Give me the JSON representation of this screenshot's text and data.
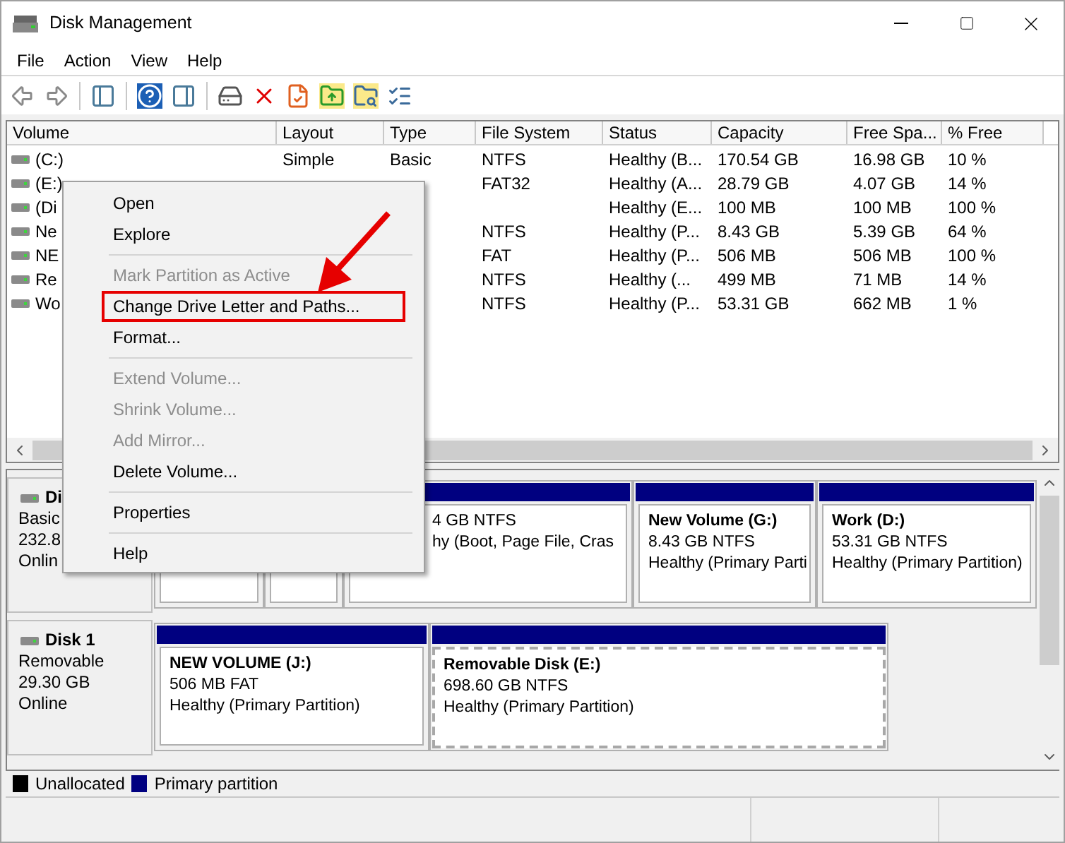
{
  "window": {
    "title": "Disk Management"
  },
  "menu_bar": [
    "File",
    "Action",
    "View",
    "Help"
  ],
  "table": {
    "columns": [
      "Volume",
      "Layout",
      "Type",
      "File System",
      "Status",
      "Capacity",
      "Free Spa...",
      "% Free"
    ],
    "rows": [
      {
        "volume": "(C:)",
        "layout": "Simple",
        "type": "Basic",
        "file_system": "NTFS",
        "status": "Healthy (B...",
        "capacity": "170.54 GB",
        "free_space": "16.98 GB",
        "percent_free": "10 %"
      },
      {
        "volume": "(E:)",
        "file_system": "FAT32",
        "status": "Healthy (A...",
        "capacity": "28.79 GB",
        "free_space": "4.07 GB",
        "percent_free": "14 %"
      },
      {
        "volume": "(Di",
        "status": "Healthy (E...",
        "capacity": "100 MB",
        "free_space": "100 MB",
        "percent_free": "100 %"
      },
      {
        "volume": "Ne",
        "file_system": "NTFS",
        "status": "Healthy (P...",
        "capacity": "8.43 GB",
        "free_space": "5.39 GB",
        "percent_free": "64 %"
      },
      {
        "volume": "NE",
        "file_system": "FAT",
        "status": "Healthy (P...",
        "capacity": "506 MB",
        "free_space": "506 MB",
        "percent_free": "100 %"
      },
      {
        "volume": "Re",
        "file_system": "NTFS",
        "status": "Healthy (...",
        "capacity": "499 MB",
        "free_space": "71 MB",
        "percent_free": "14 %"
      },
      {
        "volume": "Wo",
        "file_system": "NTFS",
        "status": "Healthy (P...",
        "capacity": "53.31 GB",
        "free_space": "662 MB",
        "percent_free": "1 %"
      }
    ]
  },
  "disks": [
    {
      "name": "Di",
      "lines": [
        "Basic",
        "232.8",
        "Onlin"
      ],
      "partitions": [
        {
          "selected": false
        },
        {
          "selected": false
        },
        {
          "size": "4 GB NTFS",
          "status": "hy (Boot, Page File, Cras",
          "selected": false
        },
        {
          "title": "New Volume  (G:)",
          "size": "8.43 GB NTFS",
          "status": "Healthy (Primary Parti",
          "selected": false
        },
        {
          "title": "Work  (D:)",
          "size": "53.31 GB NTFS",
          "status": "Healthy (Primary Partition)",
          "selected": false
        }
      ]
    },
    {
      "name": "Disk 1",
      "lines": [
        "Removable",
        "29.30 GB",
        "Online"
      ],
      "partitions": [
        {
          "title": "NEW VOLUME  (J:)",
          "size": "506 MB FAT",
          "status": "Healthy (Primary Partition)",
          "selected": false
        },
        {
          "title": "Removable Disk  (E:)",
          "size": "698.60 GB NTFS",
          "status": "Healthy (Primary Partition)",
          "selected": true
        }
      ]
    }
  ],
  "legend": [
    {
      "label": "Unallocated",
      "color": "#000000"
    },
    {
      "label": "Primary partition",
      "color": "#000080"
    }
  ],
  "context_menu": [
    {
      "kind": "item",
      "label": "Open",
      "disabled": false,
      "annotated": false
    },
    {
      "kind": "item",
      "label": "Explore",
      "disabled": false,
      "annotated": false
    },
    {
      "kind": "separator"
    },
    {
      "kind": "item",
      "label": "Mark Partition as Active",
      "disabled": true,
      "annotated": false
    },
    {
      "kind": "item",
      "label": "Change Drive Letter and Paths...",
      "disabled": false,
      "annotated": true
    },
    {
      "kind": "item",
      "label": "Format...",
      "disabled": false,
      "annotated": false
    },
    {
      "kind": "separator"
    },
    {
      "kind": "item",
      "label": "Extend Volume...",
      "disabled": true,
      "annotated": false
    },
    {
      "kind": "item",
      "label": "Shrink Volume...",
      "disabled": true,
      "annotated": false
    },
    {
      "kind": "item",
      "label": "Add Mirror...",
      "disabled": true,
      "annotated": false
    },
    {
      "kind": "item",
      "label": "Delete Volume...",
      "disabled": false,
      "annotated": false
    },
    {
      "kind": "separator"
    },
    {
      "kind": "item",
      "label": "Properties",
      "disabled": false,
      "annotated": false
    },
    {
      "kind": "separator"
    },
    {
      "kind": "item",
      "label": "Help",
      "disabled": false,
      "annotated": false
    }
  ]
}
